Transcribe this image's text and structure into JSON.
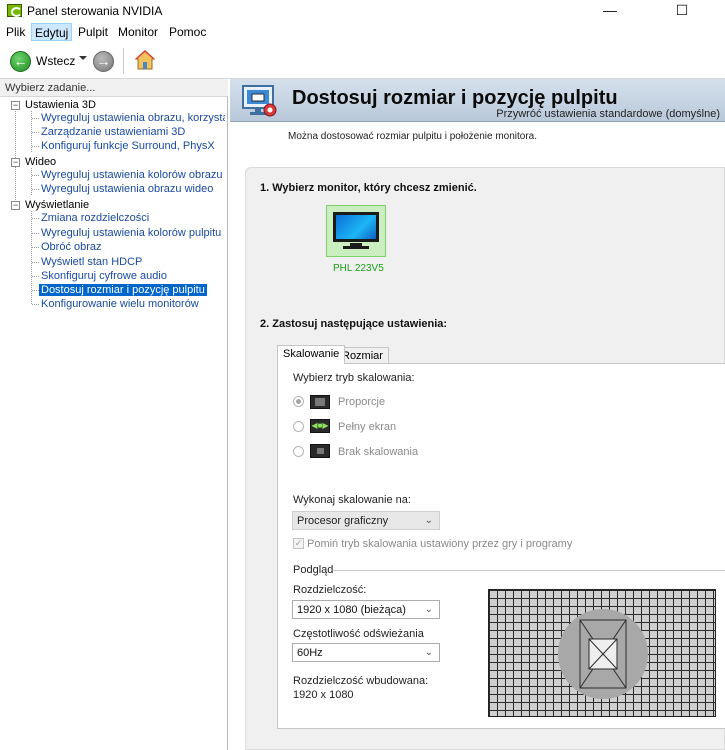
{
  "window": {
    "title": "Panel sterowania NVIDIA",
    "minimize": "—",
    "maximize": "☐",
    "close": "✕"
  },
  "menu": {
    "items": [
      "Plik",
      "Edytuj",
      "Pulpit",
      "Monitor",
      "Pomoc"
    ],
    "active": "Edytuj"
  },
  "toolbar": {
    "back_label": "Wstecz"
  },
  "left": {
    "header": "Wybierz zadanie...",
    "categories": [
      {
        "label": "Ustawienia 3D",
        "tasks": [
          "Wyreguluj ustawienia obrazu, korzystając z",
          "Zarządzanie ustawieniami 3D",
          "Konfiguruj funkcje Surround, PhysX"
        ]
      },
      {
        "label": "Wideo",
        "tasks": [
          "Wyreguluj ustawienia kolorów obrazu wideo",
          "Wyreguluj ustawienia obrazu wideo"
        ]
      },
      {
        "label": "Wyświetlanie",
        "tasks": [
          "Zmiana rozdzielczości",
          "Wyreguluj ustawienia kolorów pulpitu",
          "Obróć obraz",
          "Wyświetl stan HDCP",
          "Skonfiguruj cyfrowe audio",
          "Dostosuj rozmiar i pozycję pulpitu",
          "Konfigurowanie wielu monitorów"
        ]
      }
    ],
    "selected_task": "Dostosuj rozmiar i pozycję pulpitu"
  },
  "main": {
    "title": "Dostosuj rozmiar i pozycję pulpitu",
    "restore_link": "Przywróć ustawienia standardowe (domyślne)",
    "intro": "Można dostosować rozmiar pulpitu i położenie monitora.",
    "step1": "1. Wybierz monitor, który chcesz zmienić.",
    "monitor_name": "PHL 223V5",
    "step2": "2. Zastosuj następujące ustawienia:",
    "tabs": [
      "Skalowanie",
      "Rozmiar"
    ],
    "active_tab": "Skalowanie",
    "scaling_mode_label": "Wybierz tryb skalowania:",
    "scaling_modes": [
      "Proporcje",
      "Pełny ekran",
      "Brak skalowania"
    ],
    "selected_mode": "Proporcje",
    "perform_on_label": "Wykonaj skalowanie na:",
    "perform_on_value": "Procesor graficzny",
    "override_checkbox": "Pomiń tryb skalowania ustawiony przez gry i programy",
    "override_checked": true,
    "preview_label": "Podgląd",
    "resolution_label": "Rozdzielczość:",
    "resolution_value": "1920 x 1080 (bieżąca)",
    "refresh_label": "Częstotliwość odświeżania",
    "refresh_value": "60Hz",
    "native_label": "Rozdzielczość wbudowana:",
    "native_value": "1920 x 1080"
  },
  "colors": {
    "accent_green": "#76b900",
    "selection_blue": "#0066cc",
    "link_blue": "#1a4ba0"
  }
}
